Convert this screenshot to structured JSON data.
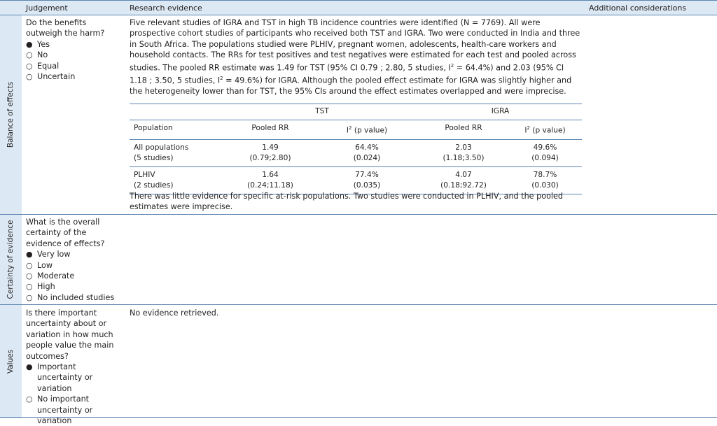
{
  "header": {
    "judgement": "Judgement",
    "research_evidence": "Research evidence",
    "additional_considerations": "Additional considerations"
  },
  "sections": [
    {
      "label": "Balance of effects",
      "question": "Do the benefits outweigh the harm?",
      "options": [
        {
          "text": "Yes",
          "selected": true
        },
        {
          "text": "No",
          "selected": false
        },
        {
          "text": "Equal",
          "selected": false
        },
        {
          "text": "Uncertain",
          "selected": false
        }
      ],
      "evidence_intro_a": "Five relevant studies of IGRA and TST in high TB incidence countries were identified (N = 7769). All were prospective cohort studies of participants who received both TST and IGRA. Two were conducted in India and three in South Africa. The populations studied were PLHIV, pregnant women, adolescents, health-care workers and household contacts. The RRs for test positives and test negatives were estimated for each test and pooled across studies. The pooled RR estimate was 1.49 for TST (95% CI 0.79 ; 2.80, 5 studies, I",
      "evidence_sup_1": "2",
      "evidence_intro_b": " = 64.4%) and 2.03 (95% CI 1.18 ; 3.50, 5 studies, I",
      "evidence_sup_2": "2",
      "evidence_intro_c": " = 49.6%) for IGRA. Although the pooled effect estimate for IGRA was slightly higher and the heterogeneity lower than for TST, the 95% CIs around the effect estimates overlapped and were imprecise.",
      "table": {
        "group_headers": [
          "TST",
          "IGRA"
        ],
        "columns": [
          "Population",
          "Pooled RR",
          "(p value)",
          "Pooled RR",
          "(p value)"
        ],
        "i2_symbol": "I",
        "i2_sup": "2",
        "rows": [
          {
            "population": "All populations",
            "population_sub": "(5 studies)",
            "tst_rr": "1.49",
            "tst_ci": "(0.79;2.80)",
            "tst_i2": "64.4%",
            "tst_p": "(0.024)",
            "igra_rr": "2.03",
            "igra_ci": "(1.18;3.50)",
            "igra_i2": "49.6%",
            "igra_p": "(0.094)"
          },
          {
            "population": "PLHIV",
            "population_sub": "(2 studies)",
            "tst_rr": "1.64",
            "tst_ci": "(0.24;11.18)",
            "tst_i2": "77.4%",
            "tst_p": "(0.035)",
            "igra_rr": "4.07",
            "igra_ci": "(0.18;92.72)",
            "igra_i2": "78.7%",
            "igra_p": "(0.030)"
          }
        ]
      },
      "evidence_outro": "There was little evidence for specific at-risk populations. Two studies were conducted in PLHIV, and the pooled estimates were imprecise."
    },
    {
      "label": "Certainty of evidence",
      "question": "What is the overall certainty of the evidence of effects?",
      "options": [
        {
          "text": "Very low",
          "selected": true
        },
        {
          "text": "Low",
          "selected": false
        },
        {
          "text": "Moderate",
          "selected": false
        },
        {
          "text": "High",
          "selected": false
        },
        {
          "text": "No included studies",
          "selected": false
        }
      ]
    },
    {
      "label": "Values",
      "question": "Is there important uncertainty about or variation in how much people value the main outcomes?",
      "options": [
        {
          "text": "Important uncertainty or variation",
          "selected": true
        },
        {
          "text": "No important uncertainty or variation",
          "selected": false
        }
      ],
      "evidence": "No evidence retrieved."
    }
  ],
  "marks": {
    "selected": "●",
    "unselected": "○"
  }
}
